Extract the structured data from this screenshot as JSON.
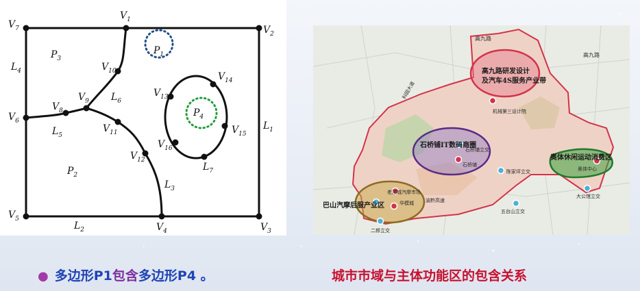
{
  "diagram": {
    "vertices": [
      "V",
      "V",
      "V",
      "V",
      "V",
      "V",
      "V",
      "V",
      "V",
      "V",
      "V",
      "V",
      "V",
      "V",
      "V",
      "V",
      "V"
    ],
    "vertex_subs": [
      "1",
      "2",
      "3",
      "4",
      "5",
      "6",
      "7",
      "8",
      "9",
      "10",
      "11",
      "12",
      "13",
      "14",
      "15",
      "16"
    ],
    "edges": [
      "L",
      "L",
      "L",
      "L",
      "L",
      "L",
      "L"
    ],
    "edge_subs": [
      "1",
      "2",
      "3",
      "4",
      "5",
      "6",
      "7"
    ],
    "polygons": [
      "P",
      "P",
      "P",
      "P"
    ],
    "polygon_subs": [
      "1",
      "2",
      "3",
      "4"
    ]
  },
  "map": {
    "labels": {
      "gaojiu_top": "高九路",
      "gaojiu_right": "高九路",
      "gaojiu_zone_line1": "高九路研发设计",
      "gaojiu_zone_line2": "及汽车4S服务产业带",
      "jixie": "机械第三设计院",
      "shiqiaopu_zone": "石桥铺IT数码商圈",
      "shiqiaopu_jiao": "石桥铺立交",
      "shiqiaopu": "石桥铺",
      "aoti_zone": "奥体休闲运动消费区",
      "aoti_center": "奥体中心",
      "chenjiaping": "陈家坪立交",
      "wutaishan": "五台山立交",
      "dagongguan": "大公馆立交",
      "laodingcheng": "老顶城汽摩市场",
      "huayangcheng": "华模城",
      "bashan_zone": "巴山汽摩后服产业区",
      "erlang": "二郎立交",
      "yuchuan": "渝黔高速",
      "shijiuroad": "科园大道"
    }
  },
  "captions": {
    "left_part1": "多边形P1",
    "left_part2": "包含",
    "left_part3": "多边形P4",
    "left_part4": " 。",
    "right": "城市市域与主体功能区的包含关系"
  },
  "colors": {
    "caption_blue": "#1f44b5",
    "caption_purple": "#7d2ea0",
    "caption_red": "#c8102e",
    "boundary": "#d2334a",
    "zone_red": "#d2334a",
    "zone_purple": "#5b2a86",
    "zone_green": "#1f7a2e",
    "zone_olive": "#8b6b1f",
    "p1_dots": "#1e4e8c",
    "p4_dots": "#1e9e3a"
  }
}
